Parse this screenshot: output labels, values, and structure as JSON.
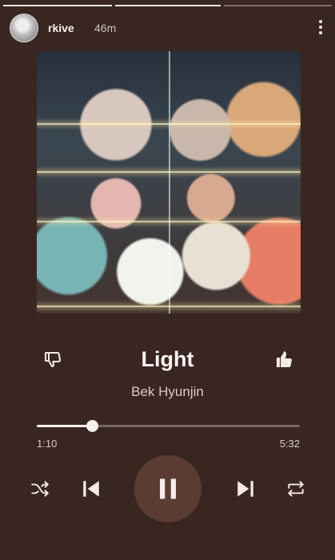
{
  "story": {
    "segment_count": 3,
    "active_segment": 2
  },
  "header": {
    "username": "rkive",
    "time_ago": "46m",
    "menu_icon": "more-vertical-icon"
  },
  "album_art": {
    "icon": "album-cover-image"
  },
  "track": {
    "title": "Light",
    "artist": "Bek Hyunjin",
    "elapsed": "1:10",
    "duration": "5:32",
    "progress_fraction": 0.21
  },
  "controls": {
    "dislike_icon": "thumb-down-icon",
    "like_icon": "thumb-up-icon",
    "shuffle_icon": "shuffle-icon",
    "previous_icon": "skip-previous-icon",
    "play_pause_icon": "pause-icon",
    "next_icon": "skip-next-icon",
    "repeat_icon": "repeat-icon"
  },
  "colors": {
    "background": "#3a2620",
    "play_button_bg": "#5a3c33",
    "text_primary": "#faf5f2"
  }
}
